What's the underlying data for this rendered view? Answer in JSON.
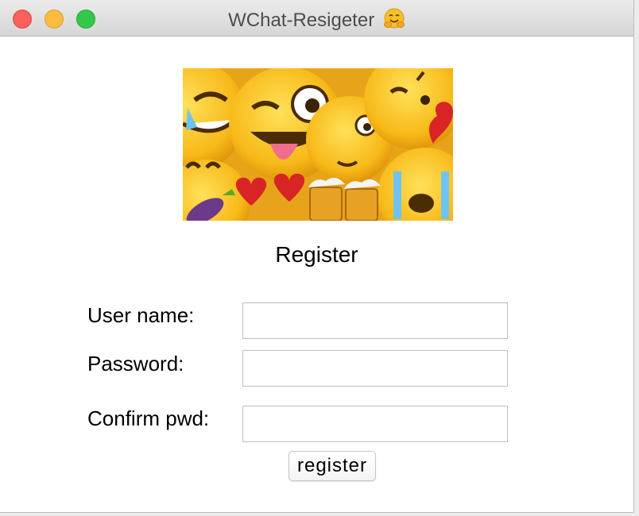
{
  "window": {
    "title": "WChat-Resigeter",
    "title_icon": "hugging-face-emoji",
    "controls": [
      "close",
      "minimize",
      "maximize"
    ]
  },
  "banner": {
    "image": "emoji-collage"
  },
  "form": {
    "heading": "Register",
    "username": {
      "label": "User name:",
      "value": "",
      "placeholder": ""
    },
    "password": {
      "label": "Password:",
      "value": "",
      "placeholder": ""
    },
    "confirm": {
      "label": "Confirm pwd:",
      "value": "",
      "placeholder": ""
    },
    "submit_label": "register"
  },
  "colors": {
    "close": "#fc605c",
    "minimize": "#fdbc40",
    "maximize": "#34c84a",
    "emoji_yellow": "#f5c12c"
  }
}
